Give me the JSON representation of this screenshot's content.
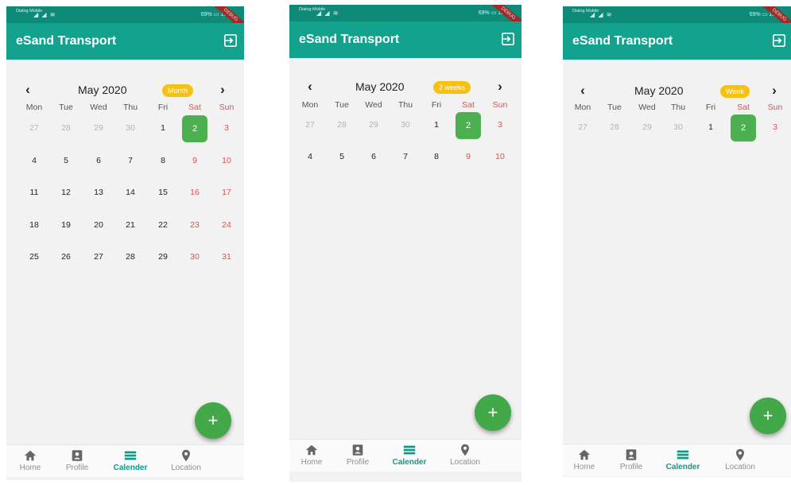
{
  "app": {
    "title": "eSand Transport"
  },
  "status": {
    "carrier": "Dialog Mobile",
    "signal": "◢ ◢ ≋",
    "right": "69% ▭ 15:",
    "banner": "DEBUG"
  },
  "calendar": {
    "month_label": "May 2020",
    "prev_icon": "chevron-left",
    "next_icon": "chevron-right"
  },
  "weekdays": [
    "Mon",
    "Tue",
    "Wed",
    "Thu",
    "Fri",
    "Sat",
    "Sun"
  ],
  "weeks": [
    [
      "27",
      "28",
      "29",
      "30",
      "1",
      "2",
      "3"
    ],
    [
      "4",
      "5",
      "6",
      "7",
      "8",
      "9",
      "10"
    ],
    [
      "11",
      "12",
      "13",
      "14",
      "15",
      "16",
      "17"
    ],
    [
      "18",
      "19",
      "20",
      "21",
      "22",
      "23",
      "24"
    ],
    [
      "25",
      "26",
      "27",
      "28",
      "29",
      "30",
      "31"
    ]
  ],
  "selected_day": "2",
  "screens": [
    {
      "format": "Month",
      "weeks_shown": 5
    },
    {
      "format": "2 weeks",
      "weeks_shown": 2
    },
    {
      "format": "Week",
      "weeks_shown": 1
    }
  ],
  "fab": {
    "label": "+"
  },
  "bottom_nav": [
    {
      "label": "Home",
      "icon": "home-icon",
      "active": false
    },
    {
      "label": "Profile",
      "icon": "profile-icon",
      "active": false
    },
    {
      "label": "Calender",
      "icon": "calendar-icon",
      "active": true
    },
    {
      "label": "Location",
      "icon": "location-icon",
      "active": false
    }
  ],
  "colors": {
    "appbar": "#13a28d",
    "statusbar": "#0e8a79",
    "badge": "#f6c20f",
    "selected": "#4caf50",
    "weekend": "#d9534f",
    "active_tab": "#0e9a86"
  }
}
